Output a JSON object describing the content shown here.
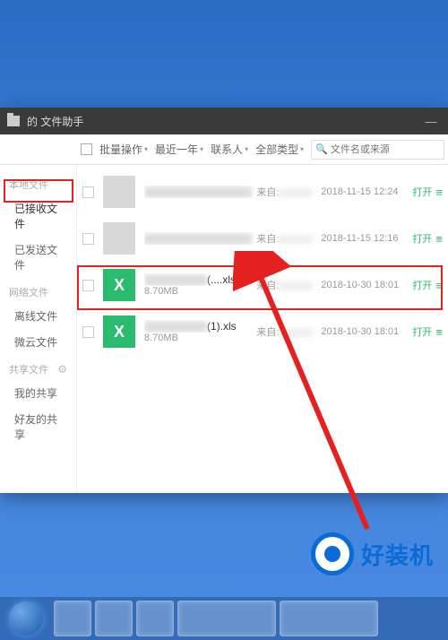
{
  "titlebar": {
    "title": "的 文件助手"
  },
  "toolbar": {
    "batch": "批量操作",
    "time_filter": "最近一年",
    "contact_filter": "联系人",
    "type_filter": "全部类型",
    "search_placeholder": "文件名或来源"
  },
  "sidebar": {
    "local_label": "本地文件",
    "local_items": [
      "已接收文件",
      "已发送文件"
    ],
    "net_label": "网络文件",
    "net_items": [
      "离线文件",
      "微云文件"
    ],
    "share_label": "共享文件",
    "share_items": [
      "我的共享",
      "好友的共享"
    ]
  },
  "from_label": "来自",
  "open_label": "打开",
  "files": [
    {
      "name_suffix": "",
      "size": "",
      "date": "2018-11-15 12:24",
      "type": "img"
    },
    {
      "name_suffix": "",
      "size": "",
      "date": "2018-11-15 12:16",
      "type": "img"
    },
    {
      "name_suffix": "(....xls",
      "size": "8.70MB",
      "date": "2018-10-30 18:01",
      "type": "xls"
    },
    {
      "name_suffix": "(1).xls",
      "size": "8.70MB",
      "date": "2018-10-30 18:01",
      "type": "xls"
    }
  ],
  "watermark": "好装机"
}
